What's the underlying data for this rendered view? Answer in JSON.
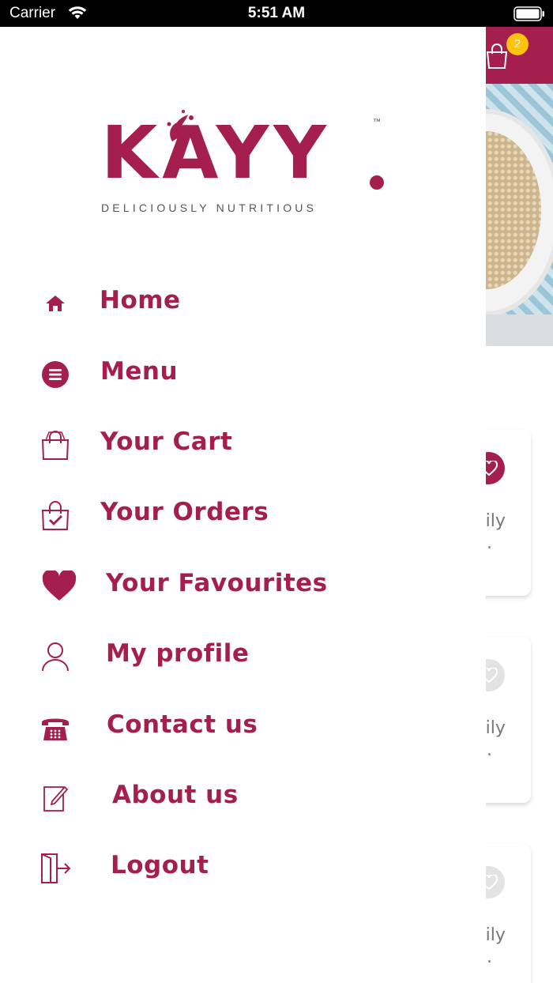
{
  "status_bar": {
    "carrier": "Carrier",
    "time": "5:51 AM"
  },
  "brand": {
    "logo_text": "KAYY",
    "trademark": "™",
    "tagline": "DELICIOUSLY NUTRITIOUS",
    "accent_color": "#a41f4d",
    "badge_color": "#ffc20e"
  },
  "drawer": {
    "items": [
      {
        "label": "Home",
        "icon": "home-icon"
      },
      {
        "label": "Menu",
        "icon": "menu-list-icon"
      },
      {
        "label": "Your Cart",
        "icon": "shopping-bag-icon"
      },
      {
        "label": "Your Orders",
        "icon": "orders-bag-check-icon"
      },
      {
        "label": "Your Favourites",
        "icon": "heart-icon"
      },
      {
        "label": "My profile",
        "icon": "user-icon"
      },
      {
        "label": "Contact us",
        "icon": "telephone-icon"
      },
      {
        "label": "About us",
        "icon": "edit-note-icon"
      },
      {
        "label": "Logout",
        "icon": "logout-door-icon"
      }
    ]
  },
  "background_page": {
    "cart_badge_count": "2",
    "cards": [
      {
        "text": "d\nlaily\nr...",
        "favourite": true
      },
      {
        "text": "d\nlaily\nr...",
        "favourite": false
      },
      {
        "text": "d\nlaily\nr...",
        "favourite": false
      }
    ]
  }
}
